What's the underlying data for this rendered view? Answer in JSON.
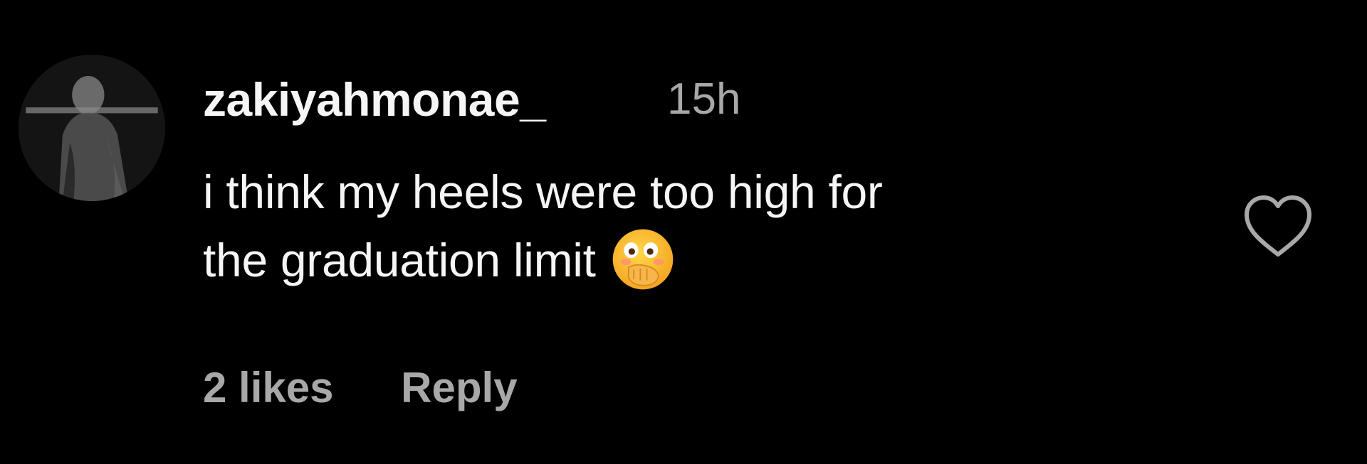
{
  "comment": {
    "username": "zakiyahmonae_",
    "timestamp": "15h",
    "text_line_1": "i think my heels were too high for",
    "text_line_2": "the graduation limit",
    "emoji": "flushed-face-hand-over-mouth-emoji",
    "likes_label": "2 likes",
    "reply_label": "Reply",
    "like_icon": "heart-outline-icon",
    "avatar_icon": "user-avatar"
  },
  "colors": {
    "background": "#000000",
    "primary_text": "#f5f5f5",
    "secondary_text": "#a8a8a8"
  }
}
